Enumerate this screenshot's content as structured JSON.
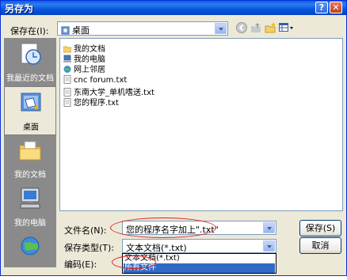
{
  "window": {
    "title": "另存为",
    "help_glyph": "?",
    "close_glyph": "✕"
  },
  "save_in": {
    "label": "保存在",
    "accel": "(I):",
    "accel_key": "I",
    "value": "桌面"
  },
  "toolbar": {
    "icons": [
      "back-icon",
      "up-folder-icon",
      "new-folder-icon",
      "view-menu-icon"
    ]
  },
  "places": [
    {
      "label": "我最近的文档",
      "icon": "recent-docs-icon",
      "selected": false
    },
    {
      "label": "桌面",
      "icon": "desktop-icon",
      "selected": true
    },
    {
      "label": "我的文档",
      "icon": "my-documents-icon",
      "selected": false
    },
    {
      "label": "我的电脑",
      "icon": "my-computer-icon",
      "selected": false
    },
    {
      "label": "",
      "icon": "network-icon",
      "selected": false
    }
  ],
  "files": [
    {
      "name": "我的文档",
      "icon": "folder-icon"
    },
    {
      "name": "我的电脑",
      "icon": "computer-icon"
    },
    {
      "name": "网上邻居",
      "icon": "network-icon"
    },
    {
      "name": "cnc forum.txt",
      "icon": "text-file-icon"
    },
    {
      "name": "东南大学_单机嗜送.txt",
      "icon": "text-file-icon"
    },
    {
      "name": "您的程序.txt",
      "icon": "text-file-icon"
    }
  ],
  "filename": {
    "label": "文件名",
    "accel": "(N):",
    "value": "您的程序名字加上\".txt\""
  },
  "savetype": {
    "label": "保存类型",
    "accel": "(T):",
    "value": "文本文档(*.txt)",
    "options": [
      "文本文档(*.txt)",
      "所有文件"
    ],
    "highlighted_index": 1
  },
  "encoding": {
    "label": "编码",
    "accel": "(E):"
  },
  "buttons": {
    "save": "保存",
    "save_accel": "(S)",
    "cancel": "取消"
  },
  "colors": {
    "title_blue": "#0A5FE9",
    "selection": "#316AC5",
    "annotation_red": "#E02020",
    "places_bg": "#8A8A8A"
  }
}
